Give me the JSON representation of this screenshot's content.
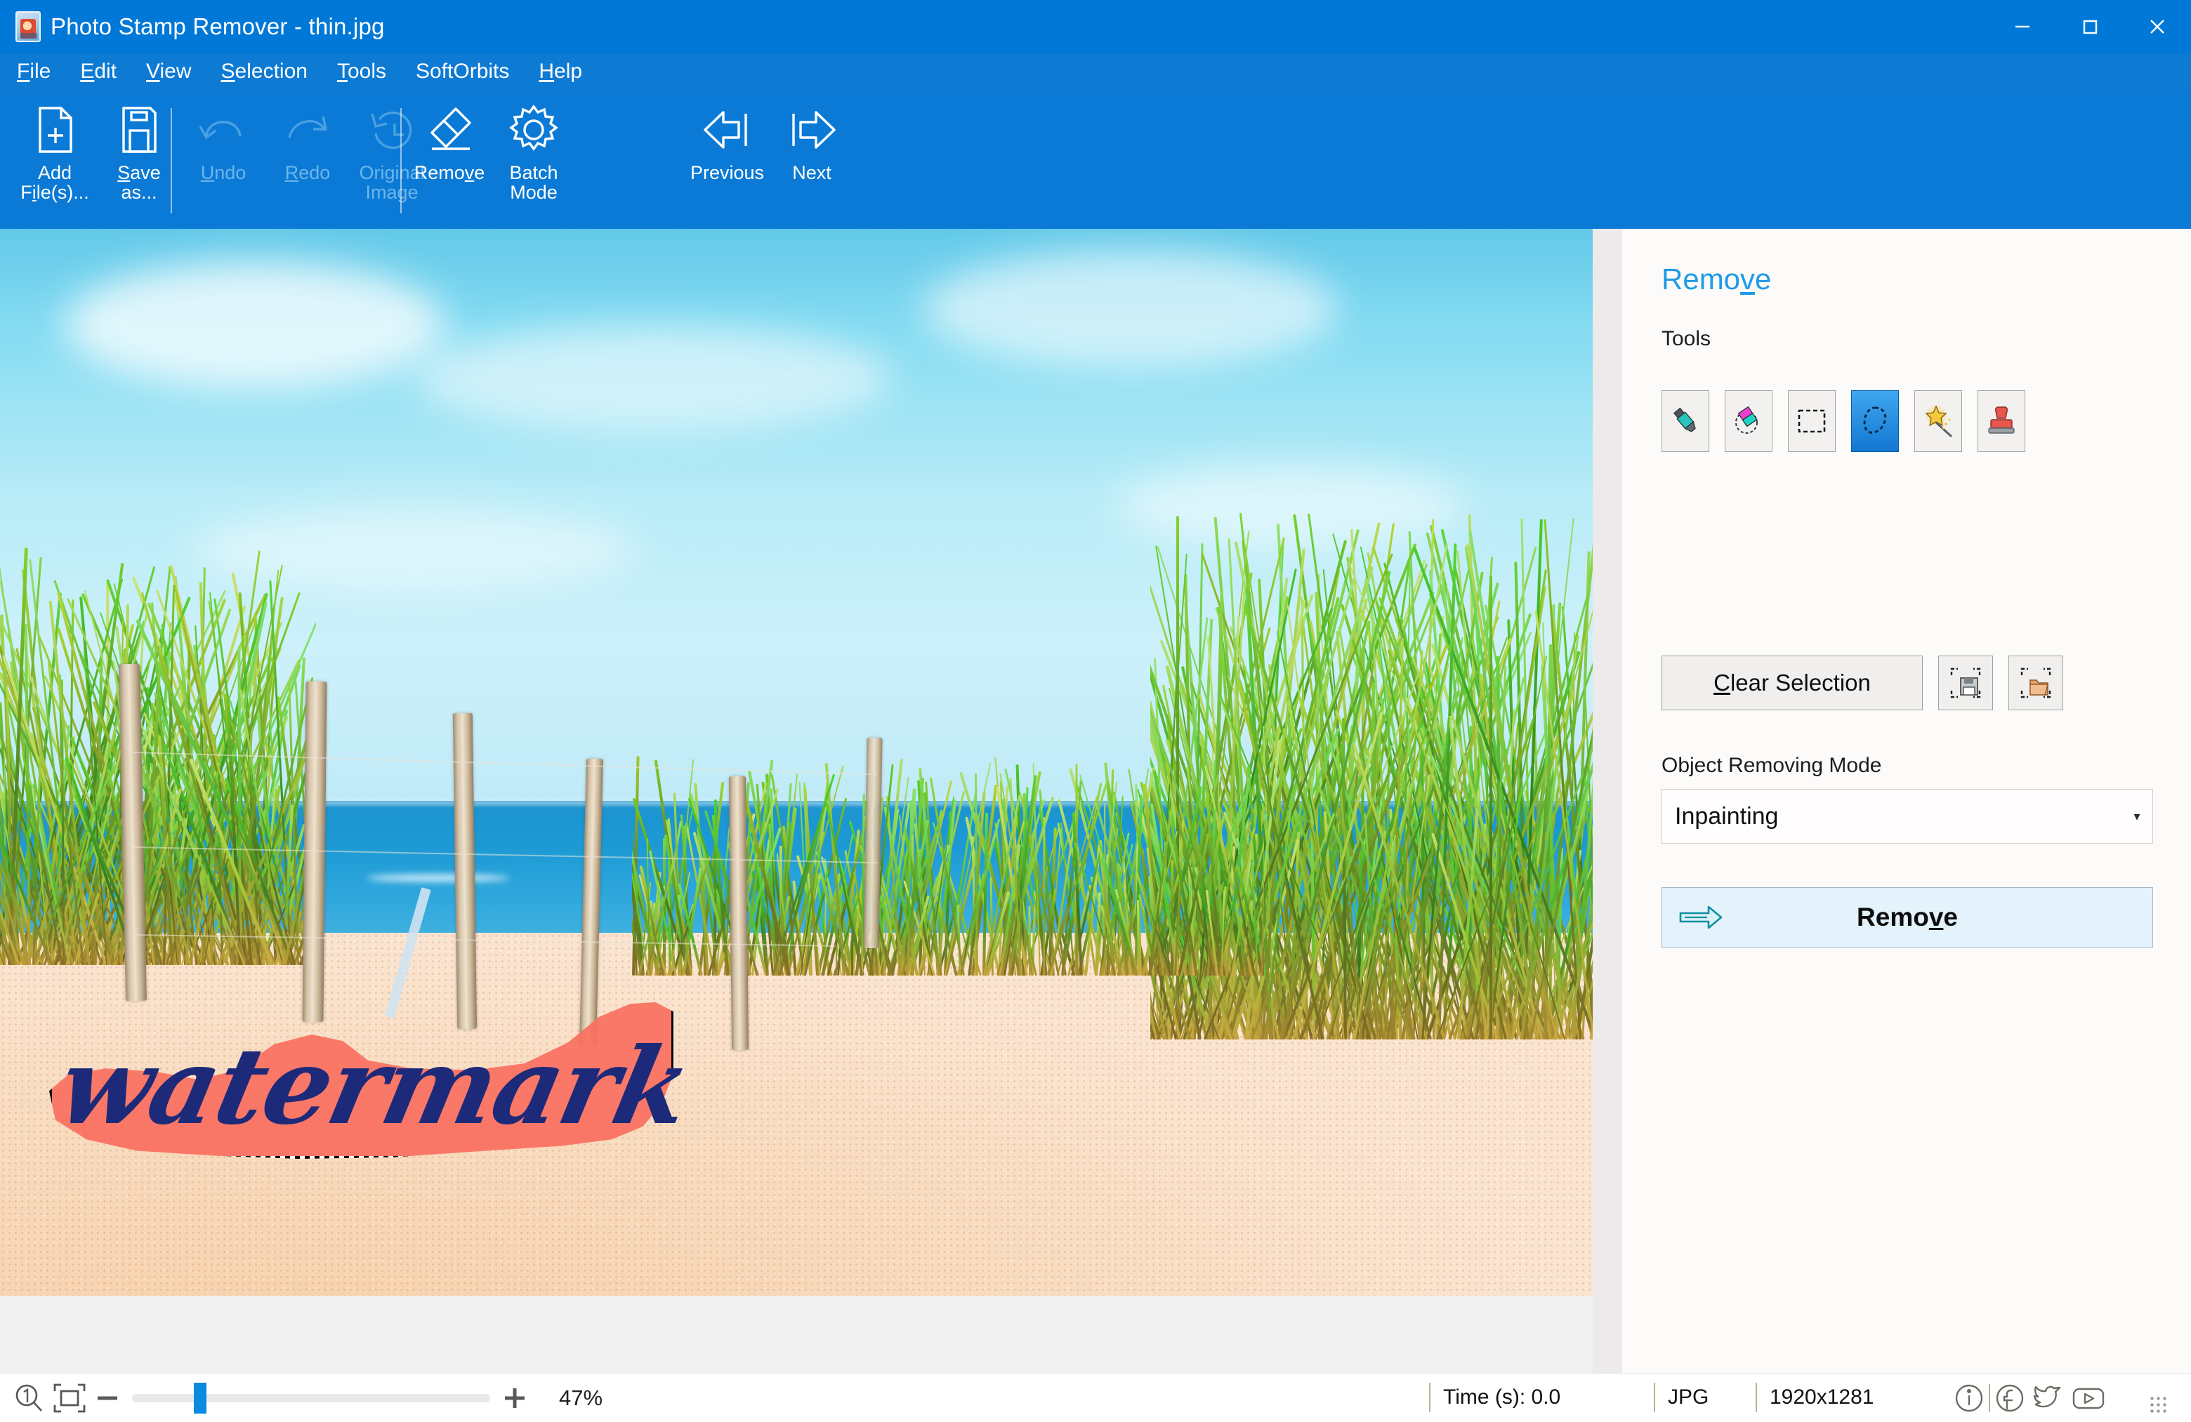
{
  "window": {
    "title": "Photo Stamp Remover - thin.jpg",
    "app_icon": "photo-app-icon",
    "controls": [
      {
        "name": "minimize",
        "glyph": "minimize-icon"
      },
      {
        "name": "maximize",
        "glyph": "maximize-icon"
      },
      {
        "name": "close",
        "glyph": "close-icon"
      }
    ]
  },
  "menubar": {
    "items": [
      {
        "label": "File",
        "accel": "F"
      },
      {
        "label": "Edit",
        "accel": "E"
      },
      {
        "label": "View",
        "accel": "V"
      },
      {
        "label": "Selection",
        "accel": "S"
      },
      {
        "label": "Tools",
        "accel": "T"
      },
      {
        "label": "SoftOrbits",
        "accel": ""
      },
      {
        "label": "Help",
        "accel": "H"
      }
    ]
  },
  "toolbar": {
    "groups": [
      {
        "name": "file",
        "buttons": [
          {
            "id": "add-files",
            "line1": "Add",
            "line2": "File(s)...",
            "icon": "add-file-icon",
            "enabled": true
          },
          {
            "id": "save-as",
            "line1": "Save",
            "line2": "as...",
            "icon": "save-icon",
            "enabled": true
          }
        ]
      },
      {
        "name": "history",
        "buttons": [
          {
            "id": "undo",
            "line1": "Undo",
            "line2": "",
            "icon": "undo-icon",
            "enabled": false
          },
          {
            "id": "redo",
            "line1": "Redo",
            "line2": "",
            "icon": "redo-icon",
            "enabled": false
          },
          {
            "id": "original-image",
            "line1": "Original",
            "line2": "Image",
            "icon": "history-clock-icon",
            "enabled": false
          }
        ]
      },
      {
        "name": "actions",
        "buttons": [
          {
            "id": "remove",
            "line1": "Remove",
            "line2": "",
            "icon": "eraser-icon",
            "enabled": true
          },
          {
            "id": "batch-mode",
            "line1": "Batch",
            "line2": "Mode",
            "icon": "gear-icon",
            "enabled": true
          }
        ]
      },
      {
        "name": "navigation",
        "buttons": [
          {
            "id": "previous",
            "line1": "Previous",
            "line2": "",
            "icon": "arrow-left-icon",
            "enabled": true
          },
          {
            "id": "next",
            "line1": "Next",
            "line2": "",
            "icon": "arrow-right-icon",
            "enabled": true
          }
        ]
      }
    ]
  },
  "canvas": {
    "selection_overlay_color": "#fa6f60",
    "watermark_text": "watermark",
    "watermark_text_color": "#1d2a7a"
  },
  "panel": {
    "title": "Remove",
    "title_accel": "v",
    "tools_label": "Tools",
    "tools": [
      {
        "id": "marker",
        "icon": "marker-pen-icon",
        "selected": false
      },
      {
        "id": "eraser",
        "icon": "eraser-tool-icon",
        "selected": false
      },
      {
        "id": "rectangle-select",
        "icon": "rectangle-select-icon",
        "selected": false
      },
      {
        "id": "lasso-select",
        "icon": "lasso-select-icon",
        "selected": true
      },
      {
        "id": "magic-wand",
        "icon": "magic-wand-icon",
        "selected": false
      },
      {
        "id": "clone-stamp",
        "icon": "clone-stamp-icon",
        "selected": false
      }
    ],
    "clear_selection_label": "Clear Selection",
    "clear_selection_accel": "C",
    "save_selection_icon": "save-selection-icon",
    "load_selection_icon": "load-selection-icon",
    "mode_label": "Object Removing Mode",
    "mode_value": "Inpainting",
    "remove_button_label": "Remove",
    "remove_button_accel": "v",
    "remove_button_icon": "arrow-right-thick-icon"
  },
  "statusbar": {
    "zoom_actual_icon": "zoom-1to1-icon",
    "zoom_fit_icon": "fit-to-window-icon",
    "zoom_out_icon": "minus-icon",
    "zoom_in_icon": "plus-icon",
    "zoom_percent": "47%",
    "time_label": "Time (s): 0.0",
    "format": "JPG",
    "dimensions": "1920x1281",
    "social": [
      {
        "id": "info",
        "icon": "info-icon"
      },
      {
        "id": "facebook",
        "icon": "facebook-icon"
      },
      {
        "id": "twitter",
        "icon": "twitter-icon"
      },
      {
        "id": "youtube",
        "icon": "youtube-icon"
      }
    ]
  }
}
